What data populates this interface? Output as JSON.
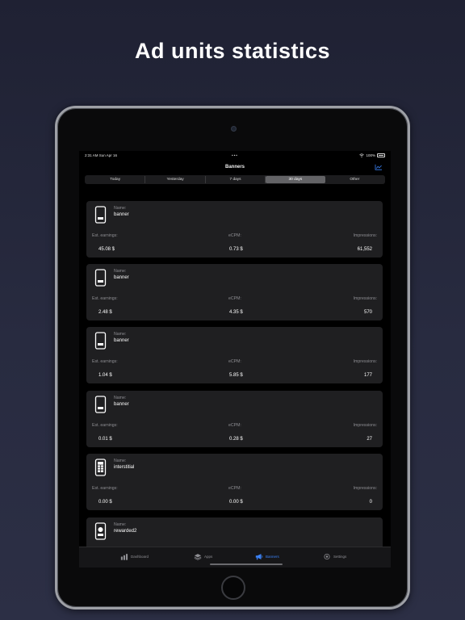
{
  "headline": "Ad units statistics",
  "status_bar": {
    "time": "2:31 AM  Sun Apr 16",
    "dots": "•••",
    "battery": "100%"
  },
  "nav": {
    "title": "Banners",
    "chart_icon": "chart-line-icon"
  },
  "segments": [
    {
      "label": "Today",
      "active": false
    },
    {
      "label": "Yesterday",
      "active": false
    },
    {
      "label": "7 days",
      "active": false
    },
    {
      "label": "30 days",
      "active": true
    },
    {
      "label": "Other",
      "active": false
    }
  ],
  "labels": {
    "name": "Name:",
    "earnings": "Est. earnings:",
    "ecpm": "eCPM:",
    "impressions": "Impressions:"
  },
  "cards": [
    {
      "name": "banner",
      "icon": "phone-banner-icon",
      "earnings": "45.08 $",
      "ecpm": "0.73 $",
      "impressions": "61,552"
    },
    {
      "name": "banner",
      "icon": "phone-banner-icon",
      "earnings": "2.48 $",
      "ecpm": "4.35 $",
      "impressions": "570"
    },
    {
      "name": "banner",
      "icon": "phone-banner-icon",
      "earnings": "1.04 $",
      "ecpm": "5.85 $",
      "impressions": "177"
    },
    {
      "name": "banner",
      "icon": "phone-banner-icon",
      "earnings": "0.01 $",
      "ecpm": "0.28 $",
      "impressions": "27"
    },
    {
      "name": "interstitial",
      "icon": "phone-interstitial-icon",
      "earnings": "0.00 $",
      "ecpm": "0.00 $",
      "impressions": "0"
    },
    {
      "name": "rewarded2",
      "icon": "phone-rewarded-icon",
      "earnings": "",
      "ecpm": "",
      "impressions": ""
    }
  ],
  "tabs": [
    {
      "label": "Dashboard",
      "icon": "bar-chart-icon",
      "active": false
    },
    {
      "label": "Apps",
      "icon": "layers-icon",
      "active": false
    },
    {
      "label": "Banners",
      "icon": "megaphone-icon",
      "active": true
    },
    {
      "label": "Settings",
      "icon": "gear-icon",
      "active": false
    }
  ],
  "colors": {
    "accent": "#3b82f6",
    "card_bg": "#1f1f21",
    "label": "#8e8e93"
  }
}
